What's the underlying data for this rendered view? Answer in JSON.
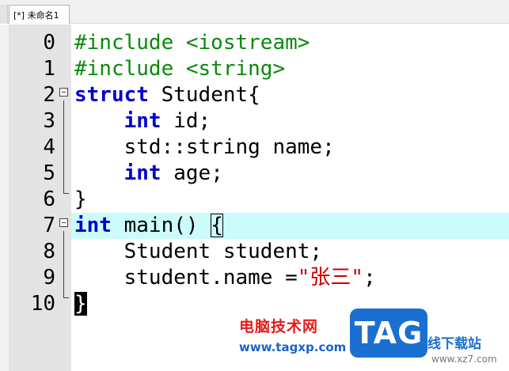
{
  "tab": {
    "label": "[*] 未命名1"
  },
  "editor": {
    "lines": [
      {
        "no": "0",
        "parts": [
          {
            "t": "#include <iostream>",
            "c": "kw-pre"
          }
        ]
      },
      {
        "no": "1",
        "parts": [
          {
            "t": "#include <string>",
            "c": "kw-pre"
          }
        ]
      },
      {
        "no": "2",
        "parts": [
          {
            "t": "struct",
            "c": "kw"
          },
          {
            "t": " Student{",
            "c": ""
          }
        ]
      },
      {
        "no": "3",
        "parts": [
          {
            "t": "    ",
            "c": ""
          },
          {
            "t": "int",
            "c": "kw"
          },
          {
            "t": " id;",
            "c": ""
          }
        ]
      },
      {
        "no": "4",
        "parts": [
          {
            "t": "    std::string name;",
            "c": ""
          }
        ]
      },
      {
        "no": "5",
        "parts": [
          {
            "t": "    ",
            "c": ""
          },
          {
            "t": "int",
            "c": "kw"
          },
          {
            "t": " age;",
            "c": ""
          }
        ]
      },
      {
        "no": "6",
        "parts": [
          {
            "t": "}",
            "c": ""
          }
        ]
      },
      {
        "no": "7",
        "parts": [
          {
            "t": "int",
            "c": "kw"
          },
          {
            "t": " main() ",
            "c": ""
          },
          {
            "t": "{",
            "c": "brace-box"
          }
        ]
      },
      {
        "no": "8",
        "parts": [
          {
            "t": "    Student student;",
            "c": ""
          }
        ]
      },
      {
        "no": "9",
        "parts": [
          {
            "t": "    student.name =",
            "c": ""
          },
          {
            "t": "\"张三\"",
            "c": "str"
          },
          {
            "t": ";",
            "c": ""
          }
        ]
      },
      {
        "no": "10",
        "parts": [
          {
            "t": "}",
            "c": "brace-match"
          }
        ]
      }
    ],
    "current_line": 7
  },
  "watermark": {
    "site_name": "电脑技术网",
    "url": "www.tagxp.com",
    "logo": "TAG",
    "side_text": "线下载站",
    "side_url": "www.xz7.com"
  },
  "colors": {
    "preprocessor": "#0a8a0a",
    "keyword": "#0000c8",
    "string": "#c80000",
    "current_line_bg": "#ccfbfb"
  }
}
